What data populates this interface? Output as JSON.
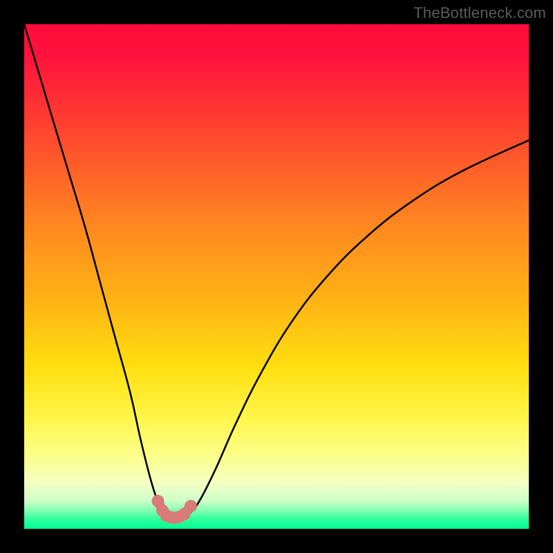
{
  "watermark": "TheBottleneck.com",
  "chart_data": {
    "type": "line",
    "title": "",
    "xlabel": "",
    "ylabel": "",
    "xlim": [
      0,
      100
    ],
    "ylim": [
      0,
      100
    ],
    "grid": false,
    "legend": false,
    "background": {
      "kind": "vertical-gradient",
      "stops": [
        {
          "pos": 0,
          "color": "#ff0b3b"
        },
        {
          "pos": 15,
          "color": "#ff2f34"
        },
        {
          "pos": 40,
          "color": "#ff8820"
        },
        {
          "pos": 68,
          "color": "#ffdf0f"
        },
        {
          "pos": 86,
          "color": "#fbff8e"
        },
        {
          "pos": 95,
          "color": "#ccffc8"
        },
        {
          "pos": 100,
          "color": "#00ff94"
        }
      ]
    },
    "series": [
      {
        "name": "bottleneck-curve",
        "color": "#000000",
        "x": [
          0,
          3,
          6,
          9,
          12,
          15,
          18,
          21,
          23,
          25,
          26.5,
          28,
          29,
          30,
          31.5,
          33,
          35,
          38,
          42,
          47,
          53,
          60,
          68,
          77,
          87,
          100
        ],
        "y": [
          100,
          90,
          80,
          70,
          60,
          49,
          38,
          27,
          18,
          10,
          5.5,
          3,
          2.3,
          2.2,
          2.4,
          3.2,
          6,
          12,
          21,
          31,
          41,
          50,
          58,
          65,
          71,
          77
        ]
      },
      {
        "name": "minimum-markers",
        "color": "#d97b78",
        "kind": "scatter",
        "x": [
          26.5,
          27.4,
          28.2,
          29.0,
          29.9,
          30.8,
          31.7,
          33.0
        ],
        "y": [
          5.5,
          3.6,
          2.6,
          2.3,
          2.2,
          2.4,
          2.9,
          4.5
        ]
      }
    ]
  }
}
